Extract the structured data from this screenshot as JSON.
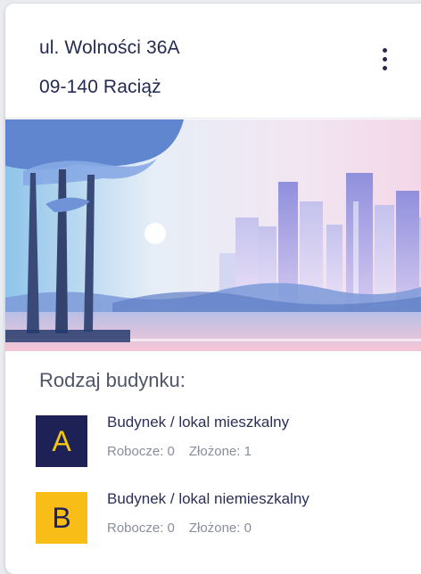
{
  "address": {
    "street": "ul. Wolności 36A",
    "city": "09-140 Raciąż"
  },
  "menu": {
    "icon": "more-vertical-icon"
  },
  "illustration": {
    "description_icon": "city-landscape-illustration"
  },
  "building_types": {
    "title": "Rodzaj budynku:",
    "items": [
      {
        "letter": "A",
        "name": "Budynek / lokal mieszkalny",
        "draft_label": "Robocze: 0",
        "submitted_label": "Złożone: 1",
        "badge_bg": "#1e2156",
        "badge_fg": "#f6c80a"
      },
      {
        "letter": "B",
        "name": "Budynek / lokal niemieszkalny",
        "draft_label": "Robocze: 0",
        "submitted_label": "Złożone: 0",
        "badge_bg": "#f9bd18",
        "badge_fg": "#1e2156"
      }
    ]
  }
}
